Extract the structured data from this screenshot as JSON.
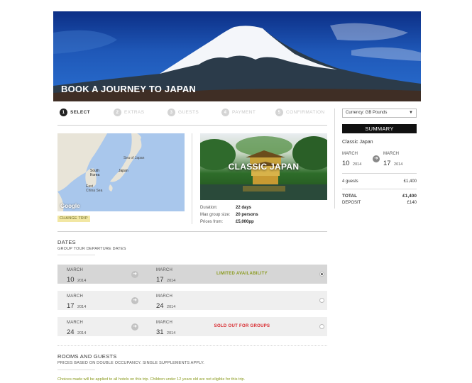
{
  "hero": {
    "title": "BOOK A JOURNEY TO JAPAN"
  },
  "steps": [
    {
      "num": "1",
      "label": "SELECT"
    },
    {
      "num": "2",
      "label": "EXTRAS"
    },
    {
      "num": "3",
      "label": "GUESTS"
    },
    {
      "num": "4",
      "label": "PAYMENT"
    },
    {
      "num": "5",
      "label": "CONFIRMATION"
    }
  ],
  "map": {
    "labels": {
      "sea_of_japan": "Sea of Japan",
      "south_korea": "South\nKorea",
      "japan": "Japan",
      "east_china_sea": "East\nChina Sea"
    },
    "watermark": "Google",
    "change_trip": "CHANGE TRIP"
  },
  "trip": {
    "name": "CLASSIC JAPAN",
    "facts": [
      {
        "key": "Duration:",
        "value": "22 days"
      },
      {
        "key": "Max group size:",
        "value": "20 persons"
      },
      {
        "key": "Prices from:",
        "value": "£5,000pp"
      }
    ]
  },
  "dates": {
    "title": "DATES",
    "subtitle": "GROUP TOUR DEPARTURE DATES",
    "rows": [
      {
        "from_month": "MARCH",
        "from_day": "10",
        "from_year": "2014",
        "to_month": "MARCH",
        "to_day": "17",
        "to_year": "2014",
        "status": "LIMITED AVAILABILITY",
        "selected": true
      },
      {
        "from_month": "MARCH",
        "from_day": "17",
        "from_year": "2014",
        "to_month": "MARCH",
        "to_day": "24",
        "to_year": "2014",
        "status": "",
        "selected": false
      },
      {
        "from_month": "MARCH",
        "from_day": "24",
        "from_year": "2014",
        "to_month": "MARCH",
        "to_day": "31",
        "to_year": "2014",
        "status": "SOLD OUT FOR GROUPS",
        "selected": false
      }
    ]
  },
  "rooms": {
    "title": "ROOMS AND GUESTS",
    "subtitle": "PRICES BASED ON DOUBLE OCCUPANCY. SINGLE SUPPLEMENTS APPLY.",
    "note": "Choices made will be applied to all hotels on this trip. Children under 12 years old are not eligible for this trip."
  },
  "sidebar": {
    "currency": "Currency: GB Pounds",
    "summary_label": "SUMMARY",
    "trip_name": "Classic Japan",
    "from": {
      "month": "MARCH",
      "day": "10",
      "year": "2014"
    },
    "to": {
      "month": "MARCH",
      "day": "17",
      "year": "2014"
    },
    "guests_label": "4 guests",
    "guests_value": "£1,400",
    "total_label": "TOTAL",
    "total_value": "£1,400",
    "deposit_label": "DEPOSIT",
    "deposit_value": "£140"
  },
  "colors": {
    "limited": "#8a9a1e",
    "sold_out": "#d8262b",
    "summary_bg": "#111111",
    "change_trip_bg": "#f2e7a3"
  }
}
